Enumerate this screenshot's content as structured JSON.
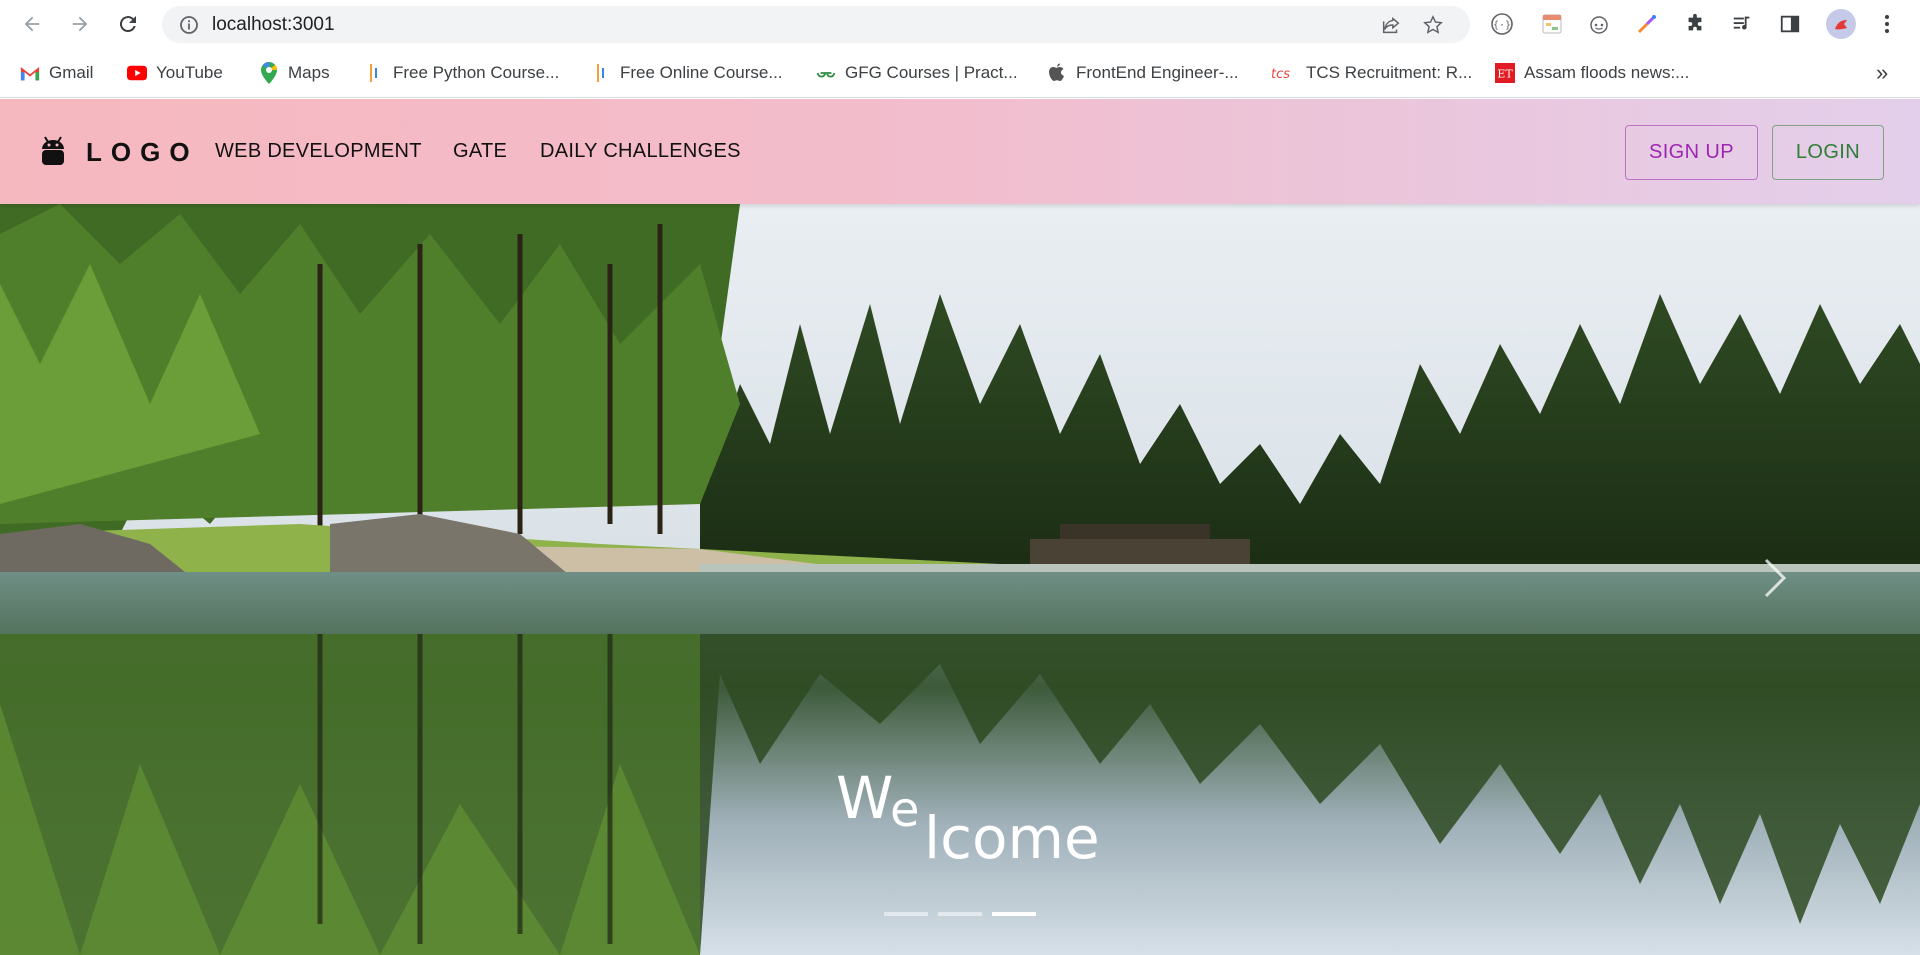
{
  "browser": {
    "url": "localhost:3001",
    "bookmarks": [
      {
        "label": "Gmail",
        "icon": "gmail-icon"
      },
      {
        "label": "YouTube",
        "icon": "youtube-icon"
      },
      {
        "label": "Maps",
        "icon": "maps-icon"
      },
      {
        "label": "Free Python Course...",
        "icon": "course-icon"
      },
      {
        "label": "Free Online Course...",
        "icon": "course-icon"
      },
      {
        "label": "GFG Courses | Pract...",
        "icon": "gfg-icon"
      },
      {
        "label": "FrontEnd Engineer-...",
        "icon": "apple-icon"
      },
      {
        "label": "TCS Recruitment: R...",
        "icon": "tcs-icon"
      },
      {
        "label": "Assam floods news:...",
        "icon": "et-icon"
      }
    ],
    "more_label": "»"
  },
  "appbar": {
    "logo_text": "LOGO",
    "menu": [
      "WEB DEVELOPMENT",
      "GATE",
      "DAILY CHALLENGES"
    ],
    "signup_label": "SIGN UP",
    "login_label": "LOGIN"
  },
  "hero": {
    "welcome_parts": [
      "W",
      "e",
      "lcome"
    ],
    "slides": 3,
    "active_slide": 3
  },
  "colors": {
    "signup": "#9c27b0",
    "login": "#2e7d32",
    "appbar_start": "#f6b8bf",
    "appbar_end": "#e3cfeb"
  }
}
